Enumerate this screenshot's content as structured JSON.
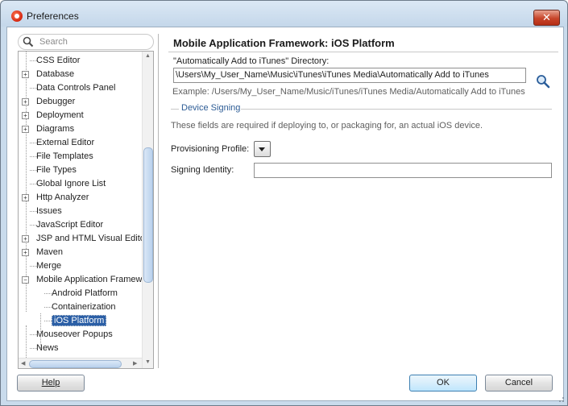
{
  "window": {
    "title": "Preferences",
    "close_glyph": "✕"
  },
  "search": {
    "placeholder": "Search"
  },
  "tree": {
    "items": [
      {
        "label": "CSS Editor",
        "expandable": false
      },
      {
        "label": "Database",
        "expandable": true
      },
      {
        "label": "Data Controls Panel",
        "expandable": false
      },
      {
        "label": "Debugger",
        "expandable": true
      },
      {
        "label": "Deployment",
        "expandable": true
      },
      {
        "label": "Diagrams",
        "expandable": true
      },
      {
        "label": "External Editor",
        "expandable": false
      },
      {
        "label": "File Templates",
        "expandable": false
      },
      {
        "label": "File Types",
        "expandable": false
      },
      {
        "label": "Global Ignore List",
        "expandable": false
      },
      {
        "label": "Http Analyzer",
        "expandable": true
      },
      {
        "label": "Issues",
        "expandable": false
      },
      {
        "label": "JavaScript Editor",
        "expandable": false
      },
      {
        "label": "JSP and HTML Visual Editor",
        "expandable": true
      },
      {
        "label": "Maven",
        "expandable": true
      },
      {
        "label": "Merge",
        "expandable": false
      },
      {
        "label": "Mobile Application Framewc",
        "expandable": true,
        "expanded": true
      },
      {
        "label": "Android Platform",
        "child": true
      },
      {
        "label": "Containerization",
        "child": true
      },
      {
        "label": "iOS Platform",
        "child": true,
        "selected": true
      },
      {
        "label": "Mouseover Popups",
        "expandable": false
      },
      {
        "label": "News",
        "expandable": false
      }
    ]
  },
  "panel": {
    "title": "Mobile Application Framework: iOS Platform",
    "itunes_dir_label": "\"Automatically Add to iTunes\" Directory:",
    "itunes_dir_value": "\\Users\\My_User_Name\\Music\\iTunes\\iTunes Media\\Automatically Add to iTunes",
    "example_text": "Example: /Users/My_User_Name/Music/iTunes/iTunes Media/Automatically Add to iTunes",
    "device_signing_header": "Device Signing",
    "device_signing_hint": "These fields are required if deploying to, or packaging for, an actual iOS device.",
    "provisioning_profile_label": "Provisioning Profile:",
    "signing_identity_label": "Signing Identity:",
    "signing_identity_value": ""
  },
  "buttons": {
    "help": "Help",
    "ok": "OK",
    "cancel": "Cancel"
  },
  "colors": {
    "selection": "#2b5fa6",
    "group_header": "#2d5c95",
    "title_bar": "#c9dbec"
  }
}
